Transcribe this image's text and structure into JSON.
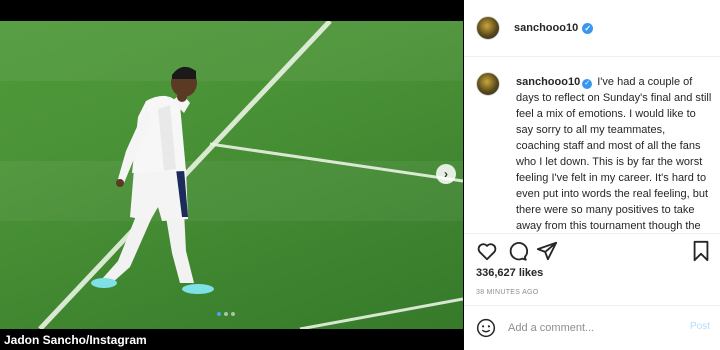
{
  "post": {
    "image_alt": "Jadon Sancho walking on the pitch",
    "credit": "Jadon Sancho/Instagram",
    "carousel": {
      "slides": 3,
      "active_index": 0,
      "next_icon": "chevron-right-icon"
    }
  },
  "header": {
    "username": "sanchooo10",
    "verified_icon": "verified-badge-icon"
  },
  "caption": {
    "username": "sanchooo10",
    "text": "I've had a couple of days to reflect on Sunday's final and still feel a mix of emotions. I would like to say sorry to all my teammates, coaching staff and most of all the fans who I let down. This is by far the worst feeling I've felt in my career. It's hard to even put into words the real feeling, but there were so many positives to take away from this tournament though the defeat will hurt for a long"
  },
  "actions": {
    "like_icon": "heart-icon",
    "comment_icon": "comment-icon",
    "share_icon": "share-icon",
    "save_icon": "bookmark-icon"
  },
  "likes": "336,627 likes",
  "timestamp": "38 MINUTES AGO",
  "comment_box": {
    "placeholder": "Add a comment...",
    "post_label": "Post",
    "emoji_icon": "emoji-icon"
  },
  "colors": {
    "pitch": "#4a9236",
    "link_blue": "#3897f0",
    "post_disabled": "#b3dbff"
  }
}
